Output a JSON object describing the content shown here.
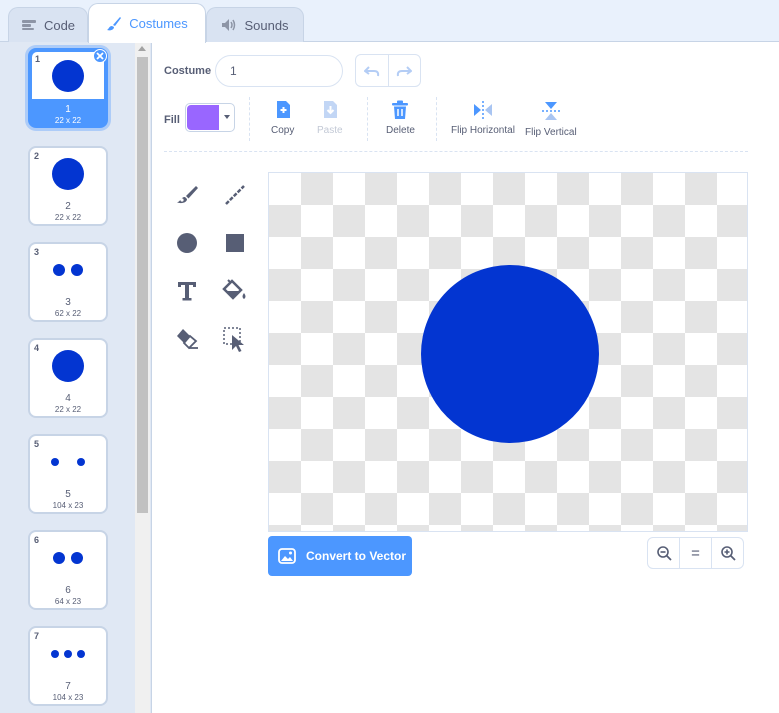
{
  "tabs": [
    {
      "label": "Code",
      "icon": "code-icon"
    },
    {
      "label": "Costumes",
      "icon": "paintbrush-icon",
      "selected": true
    },
    {
      "label": "Sounds",
      "icon": "speaker-icon"
    }
  ],
  "costumes": [
    {
      "index": "1",
      "name": "1",
      "size": "22 x 22",
      "selected": true,
      "dots": 1
    },
    {
      "index": "2",
      "name": "2",
      "size": "22 x 22",
      "dots": 1
    },
    {
      "index": "3",
      "name": "3",
      "size": "62 x 22",
      "dots": 2
    },
    {
      "index": "4",
      "name": "4",
      "size": "22 x 22",
      "dots": 1
    },
    {
      "index": "5",
      "name": "5",
      "size": "104 x 23",
      "dots": 2
    },
    {
      "index": "6",
      "name": "6",
      "size": "64 x 23",
      "dots": 2
    },
    {
      "index": "7",
      "name": "7",
      "size": "104 x 23",
      "dots": 3
    }
  ],
  "editor": {
    "costume_label": "Costume",
    "costume_name": "1",
    "fill_label": "Fill",
    "fill_color": "#9966ff",
    "actions": {
      "copy": "Copy",
      "paste": "Paste",
      "delete": "Delete",
      "flip_horizontal": "Flip Horizontal",
      "flip_vertical": "Flip Vertical"
    },
    "convert_label": "Convert to Vector",
    "zoom_reset_label": "="
  },
  "colors": {
    "accent": "#4c97ff",
    "costume_blue": "#0335d1",
    "fill_purple": "#9966ff"
  }
}
